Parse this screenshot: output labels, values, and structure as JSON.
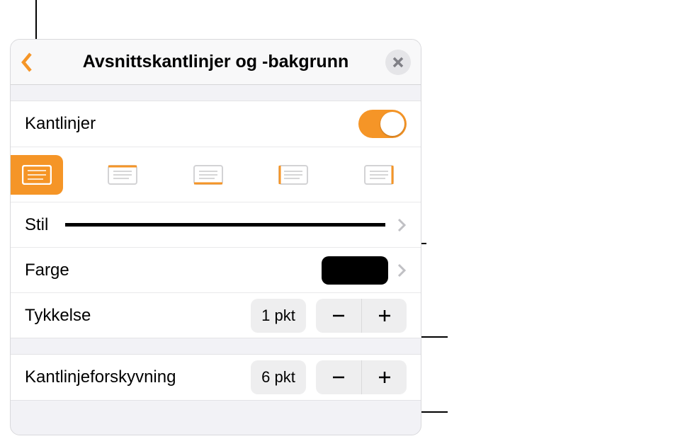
{
  "header": {
    "title": "Avsnittskantlinjer og -bakgrunn"
  },
  "borders": {
    "toggleLabel": "Kantlinjer",
    "toggleOn": true
  },
  "style": {
    "label": "Stil"
  },
  "color": {
    "label": "Farge",
    "value": "#000000"
  },
  "thickness": {
    "label": "Tykkelse",
    "value": "1 pkt"
  },
  "offset": {
    "label": "Kantlinjeforskyvning",
    "value": "6 pkt"
  }
}
